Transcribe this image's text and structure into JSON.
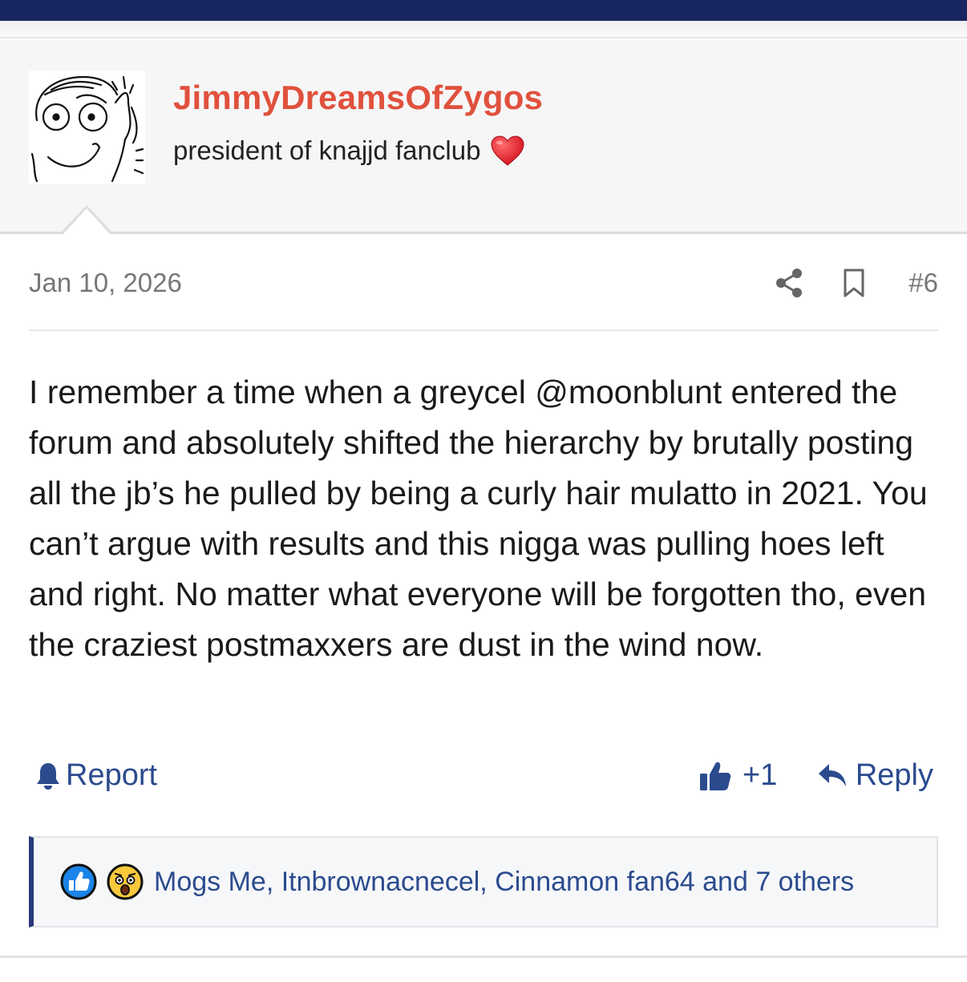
{
  "post": {
    "username": "JimmyDreamsOfZygos",
    "user_title": "president of knajjd fanclub",
    "date": "Jan 10, 2026",
    "number": "#6",
    "body": "I remember a time when a greycel @moonblunt entered the forum and absolutely shifted the hierarchy by brutally posting all the jb’s he pulled by being a curly hair mulatto in 2021. You can’t argue with results and this nigga was pulling hoes left and right. No matter what everyone will be forgotten tho, even the craziest postmaxxers are dust in the wind now."
  },
  "actions": {
    "report_label": "Report",
    "like_count": "+1",
    "reply_label": "Reply"
  },
  "reactions": {
    "summary": "Mogs Me, Itnbrownacnecel, Cinnamon fan64 and 7 others"
  },
  "icons": [
    "avatar-face",
    "heart-icon",
    "share-icon",
    "bookmark-icon",
    "bell-icon",
    "thumbs-up-icon",
    "reply-arrow-icon",
    "like-reaction-icon",
    "shocked-reaction-icon"
  ],
  "colors": {
    "topbar": "#172561",
    "username": "#e0513d",
    "link": "#2b4b8e",
    "reaction_border": "#283a7a"
  }
}
